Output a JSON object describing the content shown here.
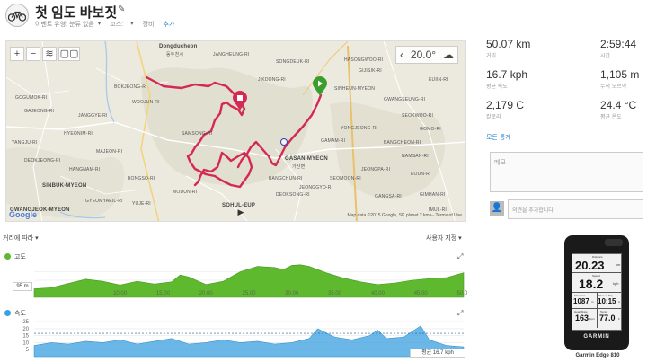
{
  "header": {
    "title": "첫 임도 바보짓",
    "event_type": "이벤트 유형: 분류 없음",
    "course": "코스:",
    "equipment": "장비:",
    "add": "추가"
  },
  "map": {
    "temperature": "20.0°",
    "google": "Google",
    "attribution": "Map data ©2015 Google, SK planet   2 km ⟝     Terms of Use",
    "scale": "2 km",
    "labels": [
      "Dongducheon",
      "동두천시",
      "GWANGJEOK-MYEON",
      "SINBUK-MYEON",
      "GASAN-MYEON",
      "가산면",
      "SOHUL-EUP",
      "YONGJEONG-RI",
      "SINHEUN-MYEON",
      "HASONGWOO-RI",
      "GIJISIK-RI",
      "GAMAM-RI",
      "BANGCHUN-RI",
      "JEONGGYO-RI",
      "DEOKSONG-RI",
      "SEOMOON-RI",
      "GOGUMOK-RI",
      "GAJEONG-RI",
      "JANGGYE-RI",
      "HYEONIM-RI",
      "MAJEON-RI",
      "YANGJU-RI",
      "DEOKJEONG-RI",
      "HANGNAM-RI",
      "GYEOMYAEIL-RI",
      "BONGSO-RI",
      "WOOJUN-RI",
      "GWANGSEUNG-RI",
      "SEOKWOO-RI",
      "BANGCHEON-RI",
      "NAMSAN-RI",
      "EOUN-RI",
      "GANGSA-RI",
      "GIMHAN-RI",
      "JEONGPA-RI",
      "EUIIN-RI",
      "GOMO-RI",
      "JANGHEUNG-RI",
      "SAMSONG-RI",
      "MODUN-RI",
      "BOKJEONG-RI",
      "SONGDEUK-RI",
      "JIKDONG-RI",
      "YUJE-RI",
      "IMUL-RI"
    ]
  },
  "stats": [
    {
      "value": "50.07 km",
      "label": "거리"
    },
    {
      "value": "2:59:44",
      "label": "시간"
    },
    {
      "value": "16.7 kph",
      "label": "평균 속도"
    },
    {
      "value": "1,105 m",
      "label": "누적 오르막"
    },
    {
      "value": "2,179 C",
      "label": "칼로리"
    },
    {
      "value": "24.4 °C",
      "label": "평균 온도"
    }
  ],
  "lap_link": "모든 통계",
  "notes_placeholder": "메모",
  "comment_placeholder": "의견을 추가합니다.",
  "controls": {
    "x_axis": "거리에 따라",
    "user_setting": "사용자 지정"
  },
  "elevation_chart": {
    "title": "고도",
    "color": "#5eb92e",
    "tick_label": "95 m",
    "x_ticks": [
      "10.00",
      "15.00",
      "20.00",
      "25.00",
      "30.00",
      "35.00",
      "40.00",
      "45.00",
      "50.00"
    ]
  },
  "speed_chart": {
    "title": "속도",
    "color": "#3aa0e0",
    "y_ticks": [
      "25",
      "20",
      "15",
      "10",
      "5"
    ],
    "avg_label": "평균",
    "avg_value": "16.7 kph"
  },
  "device": {
    "distance_label": "Distance",
    "distance_value": "20.23",
    "distance_unit": "km",
    "speed_label": "Speed",
    "speed_value": "18.2",
    "speed_unit": "kph",
    "elevation_label": "Elevation",
    "elevation_value": "1087",
    "elevation_unit": "m",
    "time_label": "Time of Day",
    "time_value": "10:15",
    "time_suffix": "A",
    "hr_label": "Heart Rate",
    "hr_value": "163",
    "hr_unit": "bpm",
    "temp_label": "Temp",
    "temp_value": "77.0",
    "temp_unit": "F",
    "brand": "GARMIN",
    "caption": "Garmin Edge 810"
  },
  "chart_data": [
    {
      "type": "area",
      "title": "고도",
      "x_ticks": [
        10,
        15,
        20,
        25,
        30,
        35,
        40,
        45,
        50
      ],
      "x": [
        0,
        2,
        4,
        6,
        8,
        10,
        12,
        14,
        16,
        17,
        18,
        20,
        22,
        24,
        26,
        28,
        29,
        30,
        31,
        32,
        34,
        36,
        38,
        40,
        42,
        44,
        46,
        48,
        50
      ],
      "series": [
        {
          "values": [
            80,
            90,
            130,
            170,
            150,
            115,
            150,
            125,
            145,
            210,
            190,
            120,
            150,
            240,
            290,
            280,
            260,
            300,
            305,
            290,
            230,
            180,
            145,
            120,
            135,
            160,
            175,
            185,
            230
          ]
        }
      ]
    },
    {
      "type": "area",
      "title": "속도",
      "y_ticks": [
        25,
        20,
        15,
        10,
        5
      ],
      "x_ticks": [
        10,
        15,
        20,
        25,
        30,
        35,
        40,
        45,
        50
      ],
      "x": [
        0,
        2,
        4,
        6,
        8,
        10,
        12,
        14,
        16,
        18,
        20,
        22,
        24,
        26,
        28,
        30,
        32,
        33,
        35,
        37,
        39,
        40,
        41,
        43,
        45,
        46,
        48,
        50
      ],
      "series": [
        {
          "values": [
            8,
            10,
            9,
            11,
            10,
            12,
            9,
            11,
            13,
            9,
            10,
            12,
            10,
            11,
            9,
            10,
            13,
            20,
            14,
            12,
            15,
            19,
            13,
            14,
            22,
            12,
            8,
            7
          ]
        }
      ]
    }
  ]
}
